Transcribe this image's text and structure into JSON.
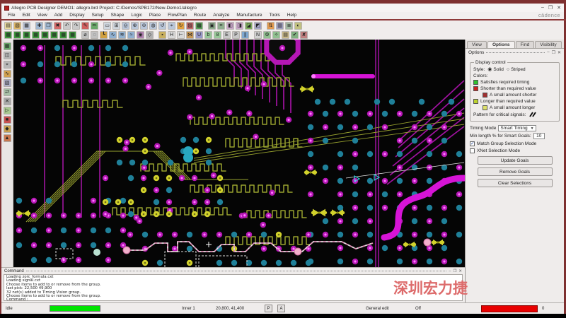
{
  "window": {
    "title": "Allegro PCB Designer DEMO1: allegro.brd Project: C:/Demos/SPB172/New-Demo1/allegro",
    "brand": "cādence",
    "controls": {
      "minimize": "–",
      "maximize": "❐",
      "close": "✕"
    }
  },
  "menu": {
    "items": [
      "File",
      "Edit",
      "View",
      "Add",
      "Display",
      "Setup",
      "Shape",
      "Logic",
      "Place",
      "FlowPlan",
      "Route",
      "Analyze",
      "Manufacture",
      "Tools",
      "Help"
    ]
  },
  "toolbars": {
    "row1": [
      {
        "n": "new-drawing",
        "g": "▤",
        "c": "#e8da9e"
      },
      {
        "n": "open-drawing",
        "g": "▧",
        "c": "#e0b96a"
      },
      {
        "n": "save-drawing",
        "g": "▦",
        "c": "#b9c2d6"
      },
      {
        "n": "move",
        "g": "✚",
        "c": "#9fb6cf",
        "gap": true
      },
      {
        "n": "copy",
        "g": "❐",
        "c": "#9fb6cf"
      },
      {
        "n": "delete",
        "g": "✖",
        "c": "#d46a6a"
      },
      {
        "n": "undo",
        "g": "↶",
        "c": "#c9c9c9"
      },
      {
        "n": "redo",
        "g": "↷",
        "c": "#c9c9c9"
      },
      {
        "n": "property-edit",
        "g": "✎",
        "c": "#d06060"
      },
      {
        "n": "signal-probe",
        "g": "✏",
        "c": "#69a869"
      },
      {
        "n": "select-window",
        "g": "▭",
        "c": "#cfd6de",
        "gap": true
      },
      {
        "n": "zoom-points",
        "g": "⊞",
        "c": "#cfd6de"
      },
      {
        "n": "zoom-fit",
        "g": "◎",
        "c": "#b9c6d9"
      },
      {
        "n": "zoom-in",
        "g": "⊕",
        "c": "#b9c6d9"
      },
      {
        "n": "zoom-out",
        "g": "⊖",
        "c": "#b9c6d9"
      },
      {
        "n": "zoom-world",
        "g": "◍",
        "c": "#b9c6d9"
      },
      {
        "n": "zoom-previous",
        "g": "↺",
        "c": "#b9c6d9"
      },
      {
        "n": "zoom-select",
        "g": "⌖",
        "c": "#b9c6d9"
      },
      {
        "n": "redraw",
        "g": "↻",
        "c": "#e0a040"
      },
      {
        "n": "shadow-mode",
        "g": "▨",
        "c": "#c46a6a"
      },
      {
        "n": "color-priority",
        "g": "▩",
        "c": "#58a058"
      },
      {
        "n": "show-element",
        "g": "▣",
        "c": "#8fae8f",
        "gap": true
      },
      {
        "n": "show-measure",
        "g": "⌗",
        "c": "#8fae8f"
      },
      {
        "n": "highlight",
        "g": "◧",
        "c": "#caa8ca"
      },
      {
        "n": "dehighlight",
        "g": "◨",
        "c": "#caa8ca"
      },
      {
        "n": "assign-color",
        "g": "◪",
        "c": "#7fae5f"
      },
      {
        "n": "label-tune",
        "g": "◩",
        "c": "#a8a8c8"
      },
      {
        "n": "flip-design",
        "g": "⇅",
        "c": "#e09a50",
        "gap": true
      },
      {
        "n": "constraint-manager",
        "g": "▥",
        "c": "#9f9fbf"
      },
      {
        "n": "cross-section",
        "g": "≣",
        "c": "#9fb69f"
      },
      {
        "n": "status",
        "g": "◐",
        "c": "#c0c080"
      }
    ],
    "row2": [
      {
        "n": "layer-select-1",
        "g": "▦",
        "c": "#3e9a3e"
      },
      {
        "n": "layer-select-2",
        "g": "▦",
        "c": "#3e9a3e"
      },
      {
        "n": "layer-select-3",
        "g": "▦",
        "c": "#3e9a3e"
      },
      {
        "n": "layer-select-4",
        "g": "▦",
        "c": "#3e9a3e"
      },
      {
        "n": "layer-select-5",
        "g": "▦",
        "c": "#3e9a3e"
      },
      {
        "n": "layer-select-6",
        "g": "▦",
        "c": "#3e9a3e"
      },
      {
        "n": "layer-select-7",
        "g": "▦",
        "c": "#3e9a3e"
      },
      {
        "n": "layer-select-8",
        "g": "▦",
        "c": "#3e9a3e"
      },
      {
        "n": "unrats-all",
        "g": "⌀",
        "c": "#c0c0c0",
        "gap": true
      },
      {
        "n": "rats-all",
        "g": "◌",
        "c": "#c0c0c0"
      },
      {
        "n": "add-connect",
        "g": "┗",
        "c": "#d0a040"
      },
      {
        "n": "slide",
        "g": "∿",
        "c": "#90b0d0"
      },
      {
        "n": "delay-tune",
        "g": "≋",
        "c": "#90b0d0"
      },
      {
        "n": "custom-smooth",
        "g": "≈",
        "c": "#90b0d0"
      },
      {
        "n": "create-via",
        "g": "◉",
        "c": "#b080b0"
      },
      {
        "n": "vertex",
        "g": "◇",
        "c": "#b0b0b0"
      },
      {
        "n": "fix",
        "g": "▪",
        "c": "#c8b060",
        "gap": true
      },
      {
        "n": "hug-trace",
        "g": "H",
        "c": "#d8d8d8"
      },
      {
        "n": "hug-contour",
        "g": "⊢",
        "c": "#d8d8d8"
      },
      {
        "n": "spread-between-voids",
        "g": "⋈",
        "c": "#c89858"
      },
      {
        "n": "via-structure",
        "g": "U",
        "c": "#9898c8"
      },
      {
        "n": "break",
        "g": "b",
        "c": "#98c898"
      },
      {
        "n": "figure-eight",
        "g": "8",
        "c": "#98c898"
      },
      {
        "n": "edit-text",
        "g": "E",
        "c": "#c8c8c8"
      },
      {
        "n": "pour-shape",
        "g": "P",
        "c": "#c8c8c8"
      },
      {
        "n": "diff-pair",
        "g": "∥",
        "c": "#80a8d0"
      },
      {
        "n": "net-schedule",
        "g": "N",
        "c": "#d0d0d0",
        "gap": true
      },
      {
        "n": "auto-route",
        "g": "⚙",
        "c": "#90c090"
      },
      {
        "n": "gloss",
        "g": "✧",
        "c": "#90c090"
      },
      {
        "n": "report",
        "g": "▤",
        "c": "#c8b888"
      },
      {
        "n": "drc-check",
        "g": "✔",
        "c": "#80b080"
      },
      {
        "n": "drc-off",
        "g": "✘",
        "c": "#c08080"
      }
    ],
    "left": [
      {
        "n": "visibility-toggle",
        "g": "▦",
        "c": "#6aa86a"
      },
      {
        "n": "snapshot",
        "g": "◫",
        "c": "#b8b8b8"
      },
      {
        "n": "coords-readout",
        "g": "⌖",
        "c": "#b8b8b8"
      },
      {
        "n": "wave-probe",
        "g": "∿",
        "c": "#d0a050"
      },
      {
        "n": "select-filter",
        "g": "▧",
        "c": "#b0b0c8"
      },
      {
        "n": "pin-swap",
        "g": "⇄",
        "c": "#a8c0a8"
      },
      {
        "n": "ratsnest-toggle",
        "g": "✕",
        "c": "#a8a8a8"
      },
      {
        "n": "flow-route",
        "g": "▷",
        "c": "#a8c890"
      },
      {
        "n": "stop-command",
        "g": "■",
        "c": "#c85050"
      },
      {
        "n": "highlight-net",
        "g": "◆",
        "c": "#c8a050"
      },
      {
        "n": "drc-markers",
        "g": "▲",
        "c": "#c87850"
      }
    ]
  },
  "panel": {
    "tabs": [
      "View",
      "Options",
      "Find",
      "Visibility"
    ],
    "active_tab": "Options",
    "title": "Options",
    "header_icons": [
      "–",
      "❐",
      "✕"
    ],
    "display_control": {
      "legend": "Display control",
      "style_label": "Style:",
      "style_options": [
        {
          "label": "Solid",
          "selected": true
        },
        {
          "label": "Striped",
          "selected": false
        }
      ],
      "colors_label": "Colors:",
      "rows": [
        {
          "label": "Satisfies required timing",
          "swatch": "#2fbf2f",
          "indent": false
        },
        {
          "label": "Shorter than required value",
          "swatch": "#cc2020",
          "indent": false
        },
        {
          "label": "A small amount shorter",
          "swatch": "#a03030",
          "indent": true
        },
        {
          "label": "Longer than required value",
          "swatch": "#bcd22e",
          "indent": false
        },
        {
          "label": "A small amount longer",
          "swatch": "#dde06a",
          "indent": true
        }
      ],
      "pattern_label": "Pattern for critical signals:"
    },
    "timing_mode_label": "Timing Mode",
    "timing_mode_value": "Smart Timing",
    "min_length_label": "Min length % for Smart Goals:",
    "min_length_value": "10",
    "checkboxes": [
      {
        "label": "Match Group Selection Mode",
        "checked": true
      },
      {
        "label": "XNet Selection Mode",
        "checked": false
      }
    ],
    "buttons": [
      "Update Goals",
      "Remove Goals",
      "Clear Selections"
    ]
  },
  "command_window": {
    "title": "Command",
    "header_icons": [
      "–",
      "❐",
      "✕"
    ],
    "lines": [
      "Loading zorc_formula.cxt",
      "Loading signal.cxt",
      "Choose items to add to or remove from the group.",
      "last pick:  22,500 49,900",
      "32 net(s) added to Timing Vision group.",
      "Choose items to add to or remove from the group.",
      "Command : "
    ]
  },
  "status_bar": {
    "state": "Idle",
    "layer": "Inner 1",
    "coords": "20,800, 41,400",
    "pick_button": "P",
    "app_button": "A",
    "mode": "General edit",
    "drc_mode": "Off",
    "drc_count": "0",
    "progress_color": "#00e400",
    "alert_color": "#e80000"
  },
  "watermark": "深圳宏力捷",
  "pcb_palette": {
    "background": "#050505",
    "magenta": "#b517b5",
    "magenta_bright": "#ff7bff",
    "purple_trace": "#a012a0",
    "magenta_thick": "#d614d6",
    "teal": "#1f8099",
    "olive": "#98a22e",
    "yellow": "#d2d22c",
    "pink": "#f2b0cc",
    "mint": "#b8e0d0",
    "white": "#e8e8e8",
    "cyan": "#35c8dc"
  }
}
